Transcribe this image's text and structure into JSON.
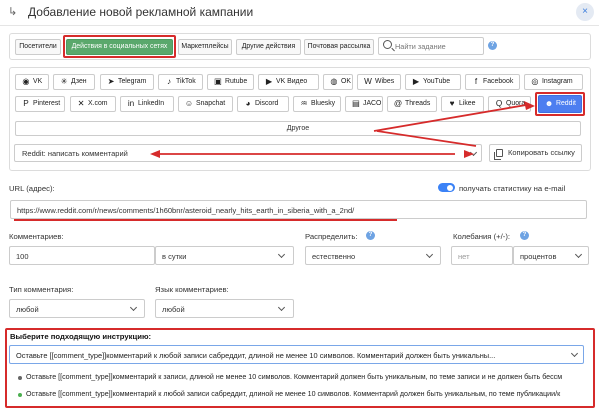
{
  "window": {
    "mark": "↳",
    "title": "Добавление новой рекламной кампании",
    "close_label": "×"
  },
  "tabs": {
    "items": [
      {
        "label": "Посетители",
        "active": false
      },
      {
        "label": "Действия в социальных сетях",
        "active": true
      },
      {
        "label": "Маркетплейсы",
        "active": false
      },
      {
        "label": "Другие действия",
        "active": false
      },
      {
        "label": "Почтовая рассылка",
        "active": false
      }
    ],
    "search_placeholder": "Найти задание",
    "help_icon": "question-icon",
    "help_text": "?"
  },
  "socials": {
    "row1": [
      {
        "label": "VK",
        "icon": "vk-icon",
        "glyph": "◉"
      },
      {
        "label": "Дзен",
        "icon": "zen-icon",
        "glyph": "✳"
      },
      {
        "label": "Telegram",
        "icon": "telegram-icon",
        "glyph": "➤"
      },
      {
        "label": "TikTok",
        "icon": "tiktok-icon",
        "glyph": "♪"
      },
      {
        "label": "Rutube",
        "icon": "rutube-icon",
        "glyph": "▣"
      },
      {
        "label": "VK Видео",
        "icon": "vk-video-icon",
        "glyph": "▶"
      },
      {
        "label": "OK",
        "icon": "ok-icon",
        "glyph": "◍"
      },
      {
        "label": "Wibes",
        "icon": "wibes-icon",
        "glyph": "W"
      },
      {
        "label": "YouTube",
        "icon": "youtube-icon",
        "glyph": "▶"
      },
      {
        "label": "Facebook",
        "icon": "facebook-icon",
        "glyph": "f"
      },
      {
        "label": "Instagram",
        "icon": "instagram-icon",
        "glyph": "◎"
      }
    ],
    "row2": [
      {
        "label": "Pinterest",
        "icon": "pinterest-icon",
        "glyph": "P"
      },
      {
        "label": "X.com",
        "icon": "x-icon",
        "glyph": "✕"
      },
      {
        "label": "LinkedIn",
        "icon": "linkedin-icon",
        "glyph": "in"
      },
      {
        "label": "Snapchat",
        "icon": "snapchat-icon",
        "glyph": "☺"
      },
      {
        "label": "Discord",
        "icon": "discord-icon",
        "glyph": "◕"
      },
      {
        "label": "Bluesky",
        "icon": "bluesky-icon",
        "glyph": "♒"
      },
      {
        "label": "JACO",
        "icon": "jaco-icon",
        "glyph": "▤"
      },
      {
        "label": "Threads",
        "icon": "threads-icon",
        "glyph": "@"
      },
      {
        "label": "Likee",
        "icon": "likee-icon",
        "glyph": "♥"
      },
      {
        "label": "Quora",
        "icon": "quora-icon",
        "glyph": "Q"
      },
      {
        "label": "Reddit",
        "icon": "reddit-icon",
        "glyph": "☻"
      }
    ],
    "other_label": "Другое",
    "selected": "Reddit"
  },
  "task": {
    "selected": "Reddit: написать комментарий",
    "copy_label": "Копировать ссылку"
  },
  "url": {
    "label": "URL (адрес):",
    "stats_label": "получать статистику на e-mail",
    "stats_on": true,
    "value": "https://www.reddit.com/r/news/comments/1h60bnr/asteroid_nearly_hits_earth_in_siberia_with_a_2nd/"
  },
  "params": {
    "comments_label": "Комментариев:",
    "comments_value": "100",
    "period_value": "в сутки",
    "distribute_label": "Распределить:",
    "distribute_value": "естественно",
    "fluct_label": "Колебания (+/-):",
    "fluct_value": "нет",
    "fluct_unit": "процентов"
  },
  "types": {
    "comment_type_label": "Тип комментария:",
    "comment_type_value": "любой",
    "language_label": "Язык комментариев:",
    "language_value": "любой"
  },
  "instruction": {
    "label": "Выберите подходящую инструкцию:",
    "selected": "Оставьте [[comment_type]]комментарий к любой записи сабреддит, длиной не менее 10 символов. Комментарий должен быть уникальны...",
    "options": [
      {
        "text": "Оставьте [[comment_type]]комментарий к записи, длиной не менее 10 символов. Комментарий должен быть уникальным, по теме записи и не должен быть бессм",
        "dot_color": "#666666"
      },
      {
        "text": "Оставьте [[comment_type]]комментарий к любой записи сабреддит, длиной не менее 10 символов. Комментарий должен быть уникальным, по теме публикации/к",
        "dot_color": "#4caf50"
      }
    ]
  },
  "colors": {
    "accent_green": "#5aa86c",
    "accent_blue": "#4d7ef0",
    "annotation_red": "#d62b2b"
  }
}
